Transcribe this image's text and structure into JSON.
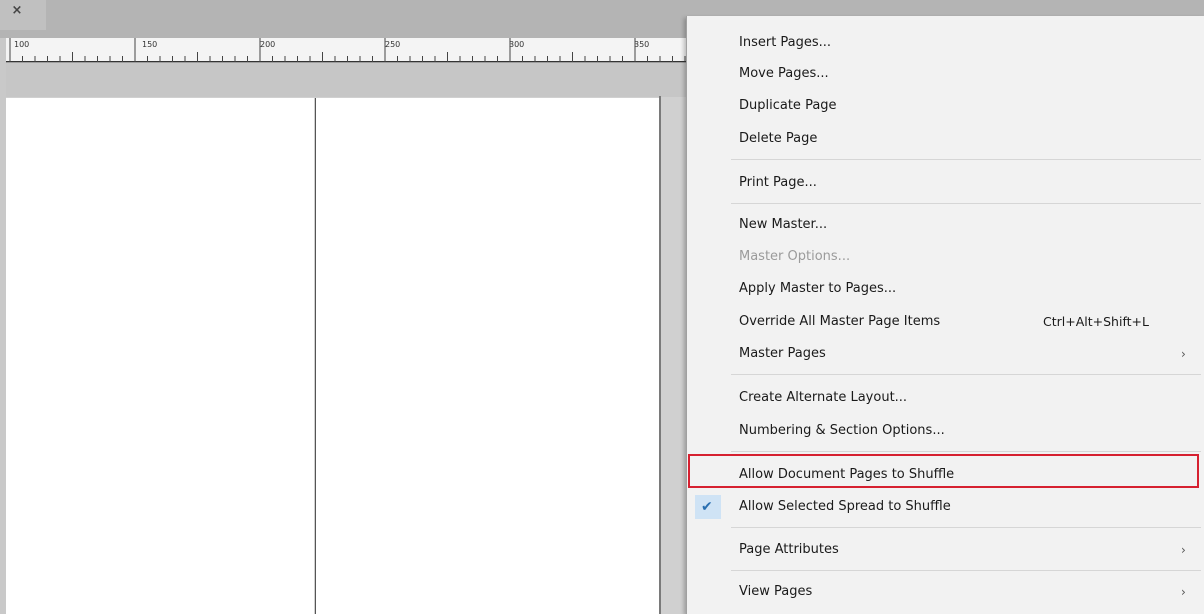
{
  "window": {
    "close_glyph": "×"
  },
  "ruler": {
    "ticks": [
      "100",
      "150",
      "200",
      "250",
      "300",
      "350"
    ]
  },
  "menu": {
    "items": [
      {
        "label": "Insert Pages...",
        "enabled": true
      },
      {
        "label": "Move Pages...",
        "enabled": true
      },
      {
        "label": "Duplicate Page",
        "enabled": true
      },
      {
        "label": "Delete Page",
        "enabled": true
      },
      {
        "label": "Print Page...",
        "enabled": true
      },
      {
        "label": "New Master...",
        "enabled": true
      },
      {
        "label": "Master Options...",
        "enabled": false
      },
      {
        "label": "Apply Master to Pages...",
        "enabled": true
      },
      {
        "label": "Override All Master Page Items",
        "enabled": true,
        "shortcut": "Ctrl+Alt+Shift+L"
      },
      {
        "label": "Master Pages",
        "enabled": true,
        "submenu": true
      },
      {
        "label": "Create Alternate Layout...",
        "enabled": true
      },
      {
        "label": "Numbering & Section Options...",
        "enabled": true
      },
      {
        "label": "Allow Document Pages to Shuffle",
        "enabled": true,
        "highlighted": true
      },
      {
        "label": "Allow Selected Spread to Shuffle",
        "enabled": true,
        "checked": true
      },
      {
        "label": "Page Attributes",
        "enabled": true,
        "submenu": true
      },
      {
        "label": "View Pages",
        "enabled": true,
        "submenu": true
      }
    ],
    "submenu_arrow": "›",
    "check_glyph": "✔"
  },
  "colors": {
    "highlight_border": "#d62030",
    "check_bg": "#cfe3f5",
    "check": "#2a6fb0"
  }
}
